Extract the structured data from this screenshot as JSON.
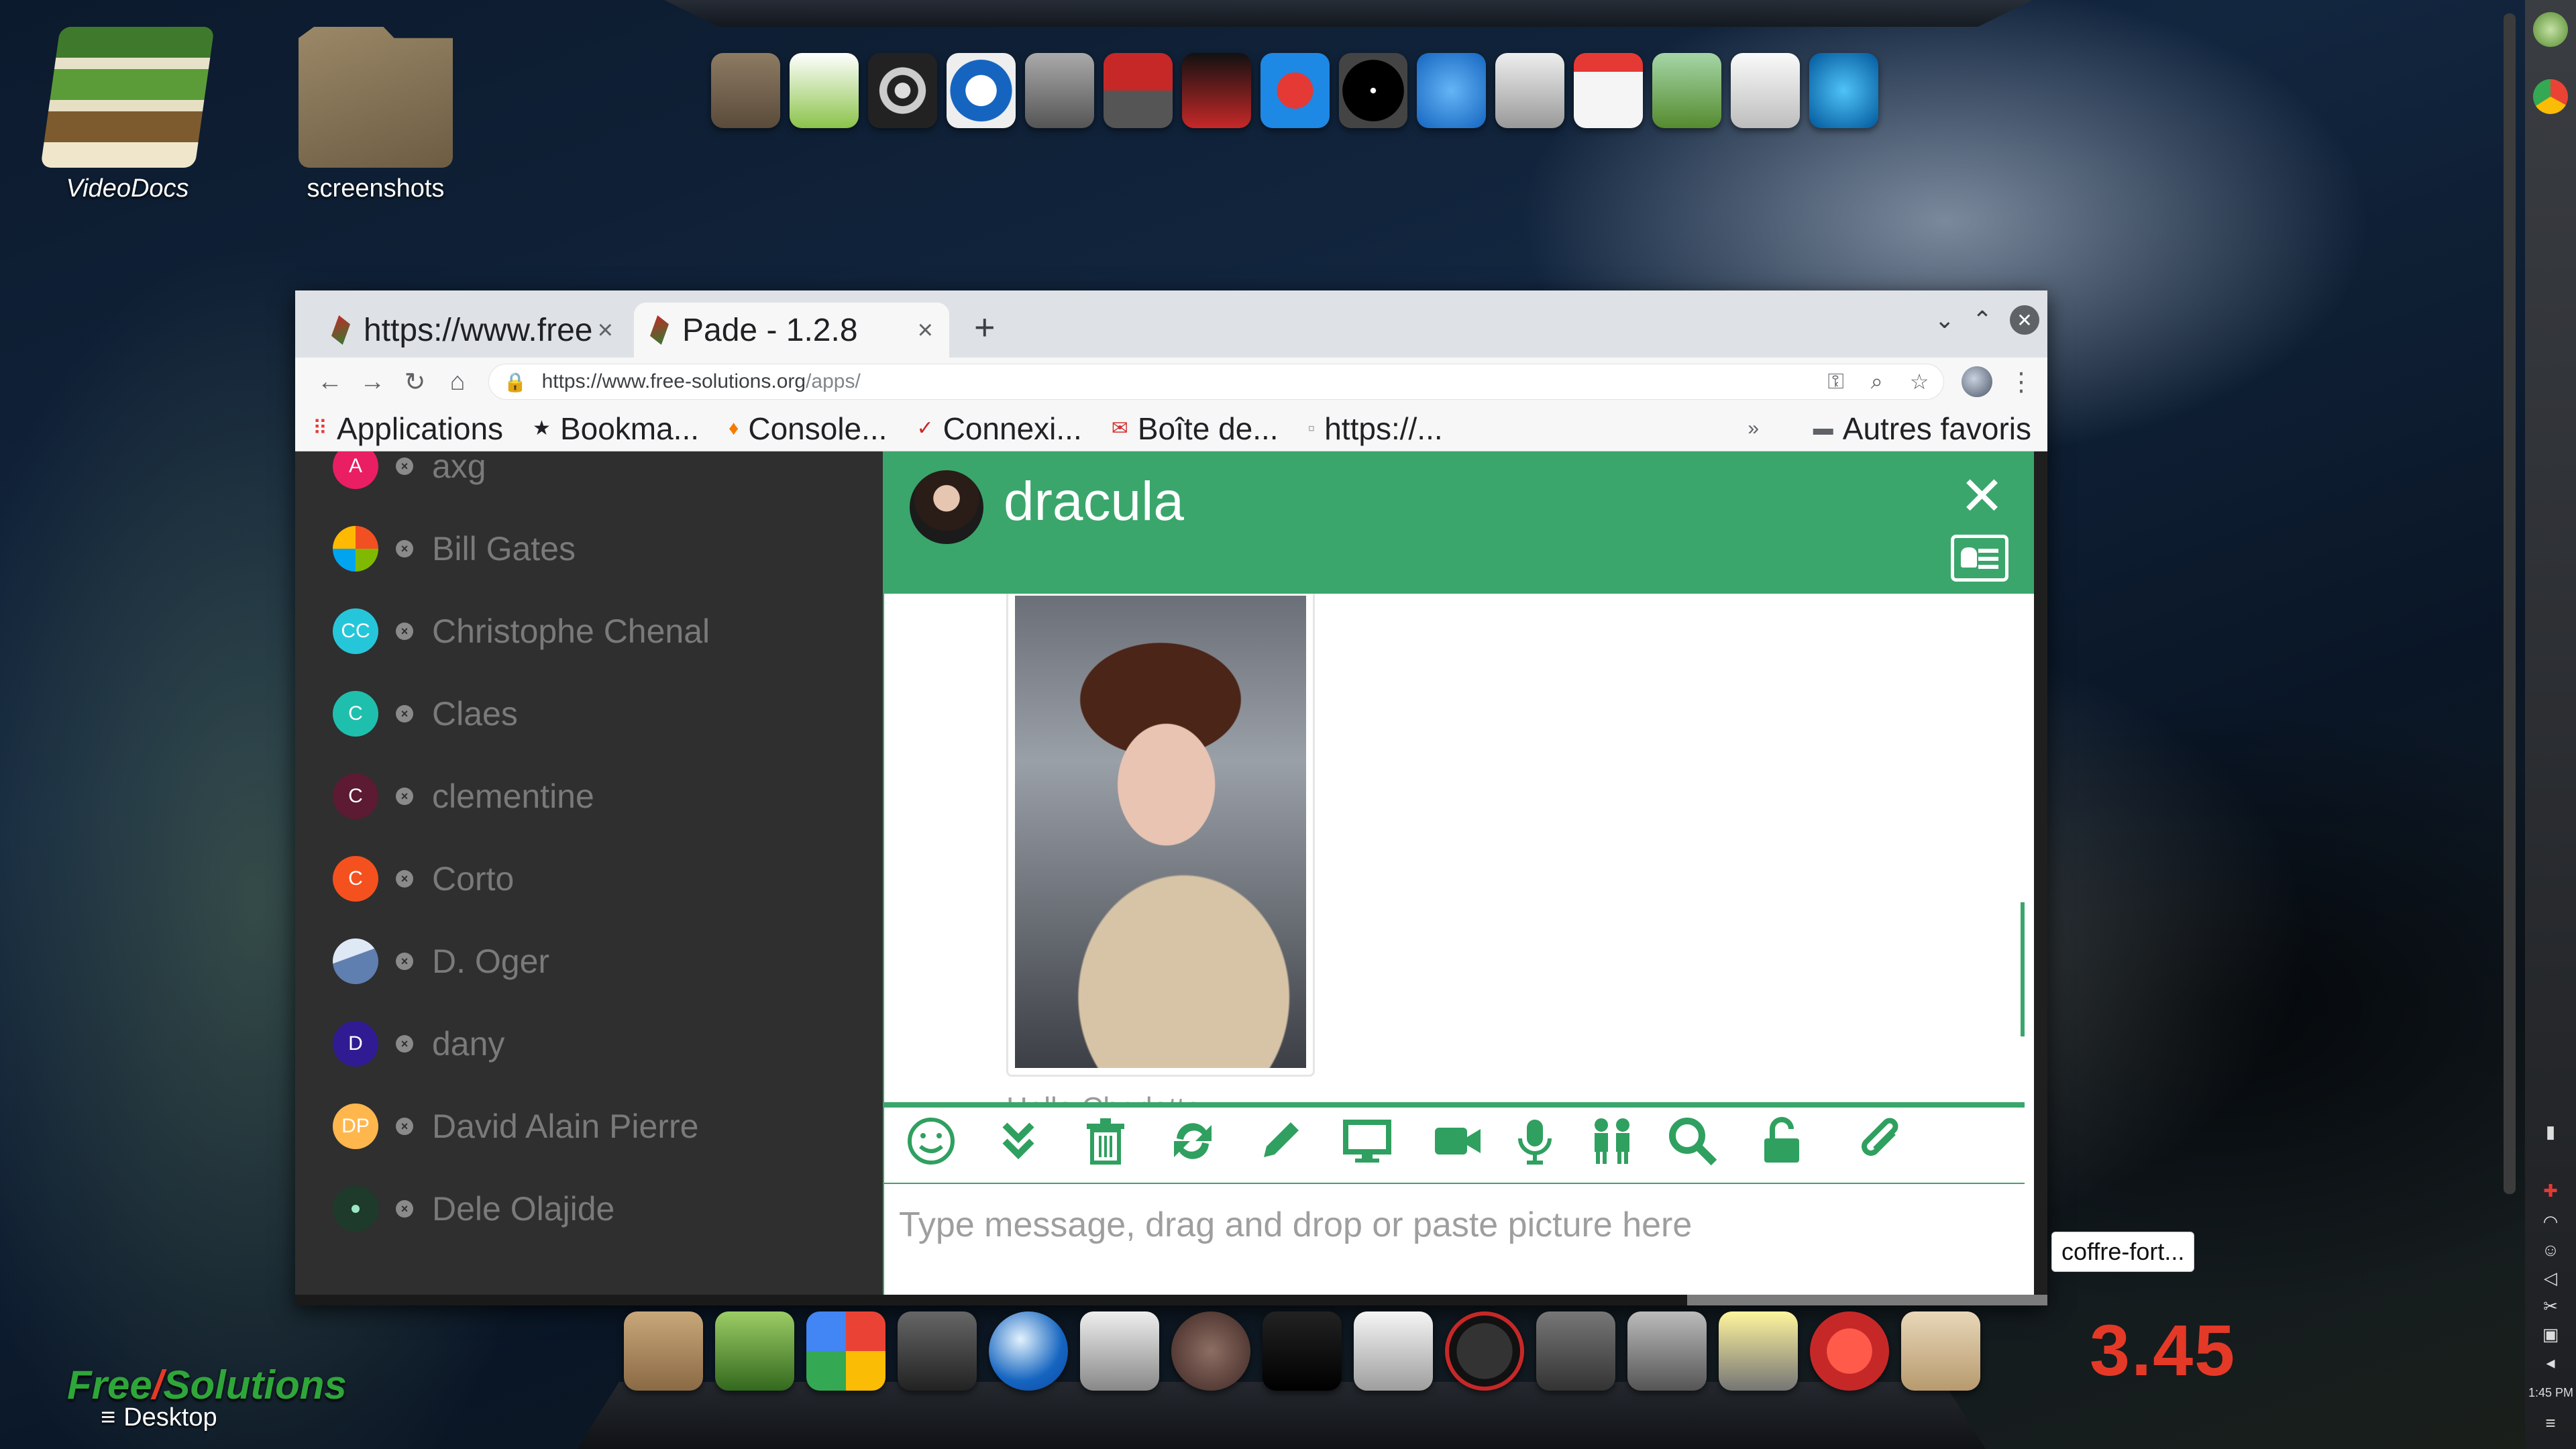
{
  "desktop": {
    "icons": [
      {
        "label": "VideoDocs"
      },
      {
        "label": "screenshots"
      }
    ],
    "tooltip": "coffre-fort...",
    "clock": "3.45",
    "brand": {
      "part1": "Free",
      "slash": "/",
      "part2": "Solutions"
    },
    "desktop_label": "Desktop",
    "systray_time": "1:45 PM"
  },
  "browser": {
    "tabs": [
      {
        "title": "https://www.free-solutions.org/apps/",
        "close": "×"
      },
      {
        "title": "Pade - 1.2.8",
        "close": "×",
        "active": true
      }
    ],
    "new_tab": "+",
    "url_host": "https://www.free-solutions.org",
    "url_path": "/apps/",
    "bookmarks": [
      {
        "label": "Applications",
        "icon": "apps-grid-icon"
      },
      {
        "label": "Bookma...",
        "icon": "star-icon"
      },
      {
        "label": "Console...",
        "icon": "fire-icon"
      },
      {
        "label": "Connexi...",
        "icon": "leaf-icon"
      },
      {
        "label": "Boîte de...",
        "icon": "mail-icon"
      },
      {
        "label": "https://...",
        "icon": "page-icon"
      }
    ],
    "bookmarks_more": "»",
    "other_bookmarks": "Autres favoris"
  },
  "contacts": [
    {
      "name": "axg",
      "initials": "A",
      "color": "#e91e63"
    },
    {
      "name": "Bill Gates",
      "initials": "",
      "color": "#ffffff"
    },
    {
      "name": "Christophe Chenal",
      "initials": "CC",
      "color": "#26c6da"
    },
    {
      "name": "Claes",
      "initials": "C",
      "color": "#1fbfae"
    },
    {
      "name": "clementine",
      "initials": "C",
      "color": "#5c1a33"
    },
    {
      "name": "Corto",
      "initials": "C",
      "color": "#f4511e"
    },
    {
      "name": "D. Oger",
      "initials": "",
      "color": "#5f7fb0"
    },
    {
      "name": "dany",
      "initials": "D",
      "color": "#311b92"
    },
    {
      "name": "David Alain Pierre",
      "initials": "DP",
      "color": "#ffb74d"
    },
    {
      "name": "Dele Olajide",
      "initials": "",
      "color": "#1e3a2b"
    }
  ],
  "chat": {
    "contact_name": "dracula",
    "close": "✕",
    "message_author_peek": "Hello Charlotte",
    "composer_placeholder": "Type message, drag and drop or paste picture here",
    "accent": "#3aa66b",
    "tools": [
      "smile-icon",
      "chevrons-down-icon",
      "trash-icon",
      "refresh-icon",
      "pencil-icon",
      "monitor-icon",
      "video-icon",
      "microphone-icon",
      "people-icon",
      "search-icon",
      "unlock-icon",
      "paperclip-icon"
    ]
  }
}
